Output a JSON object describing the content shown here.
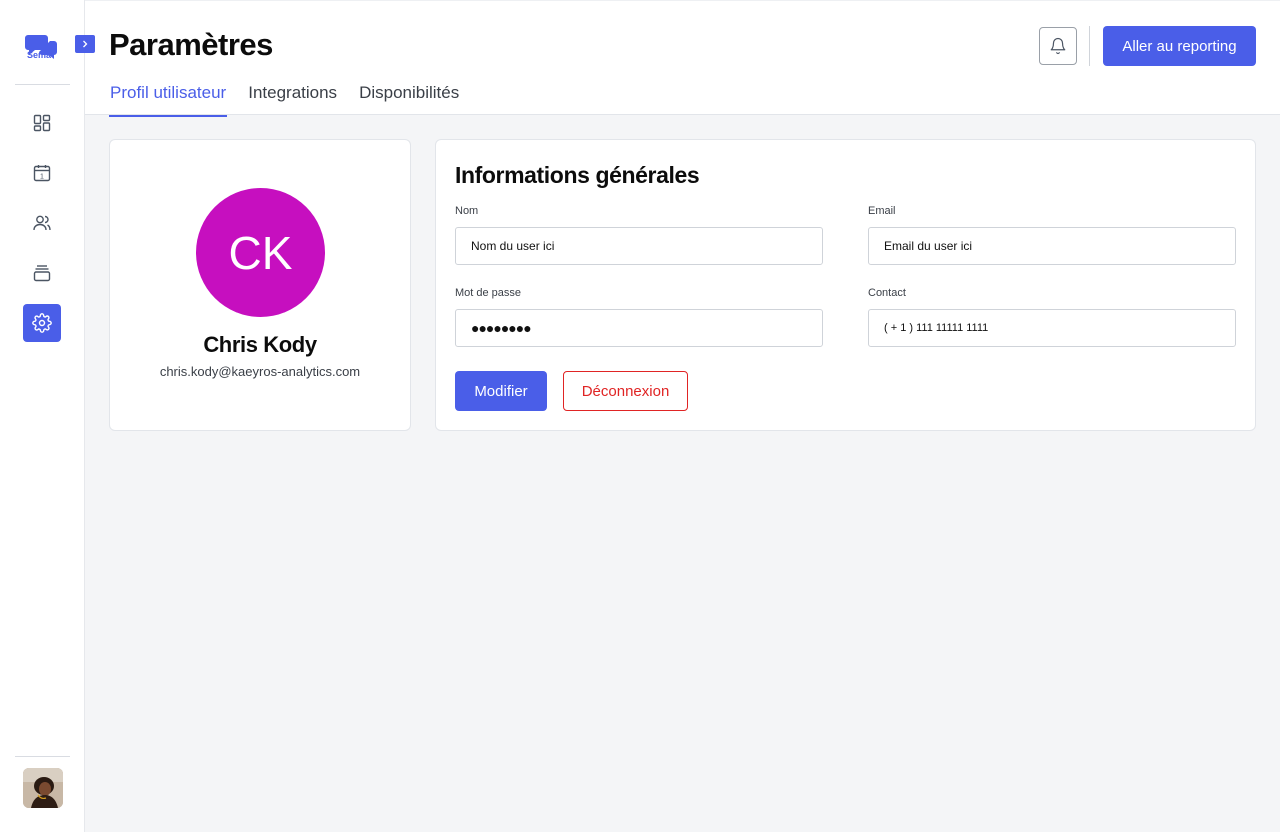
{
  "app": {
    "logo_text": "Sema",
    "brand_color": "#4a5ee8"
  },
  "sidebar": {
    "items": [
      {
        "icon": "dashboard-icon"
      },
      {
        "icon": "calendar-icon",
        "badge": "1"
      },
      {
        "icon": "users-icon"
      },
      {
        "icon": "stack-icon"
      },
      {
        "icon": "gear-icon",
        "active": true
      }
    ]
  },
  "header": {
    "title": "Paramètres",
    "report_button": "Aller au reporting",
    "tabs": [
      {
        "label": "Profil utilisateur",
        "active": true
      },
      {
        "label": "Integrations"
      },
      {
        "label": "Disponibilités"
      }
    ]
  },
  "profile": {
    "initials": "CK",
    "avatar_color": "#c60fbf",
    "name": "Chris Kody",
    "email": "chris.kody@kaeyros-analytics.com"
  },
  "info": {
    "title": "Informations générales",
    "fields": {
      "name": {
        "label": "Nom",
        "value": "Nom du user ici"
      },
      "email": {
        "label": "Email",
        "value": "Email du user ici"
      },
      "password": {
        "label": "Mot de passe",
        "value": "●●●●●●●●"
      },
      "contact": {
        "label": "Contact",
        "value": "( + 1 ) 111 11111 1111"
      }
    },
    "modify_button": "Modifier",
    "logout_button": "Déconnexion",
    "danger_color": "#e02424"
  }
}
